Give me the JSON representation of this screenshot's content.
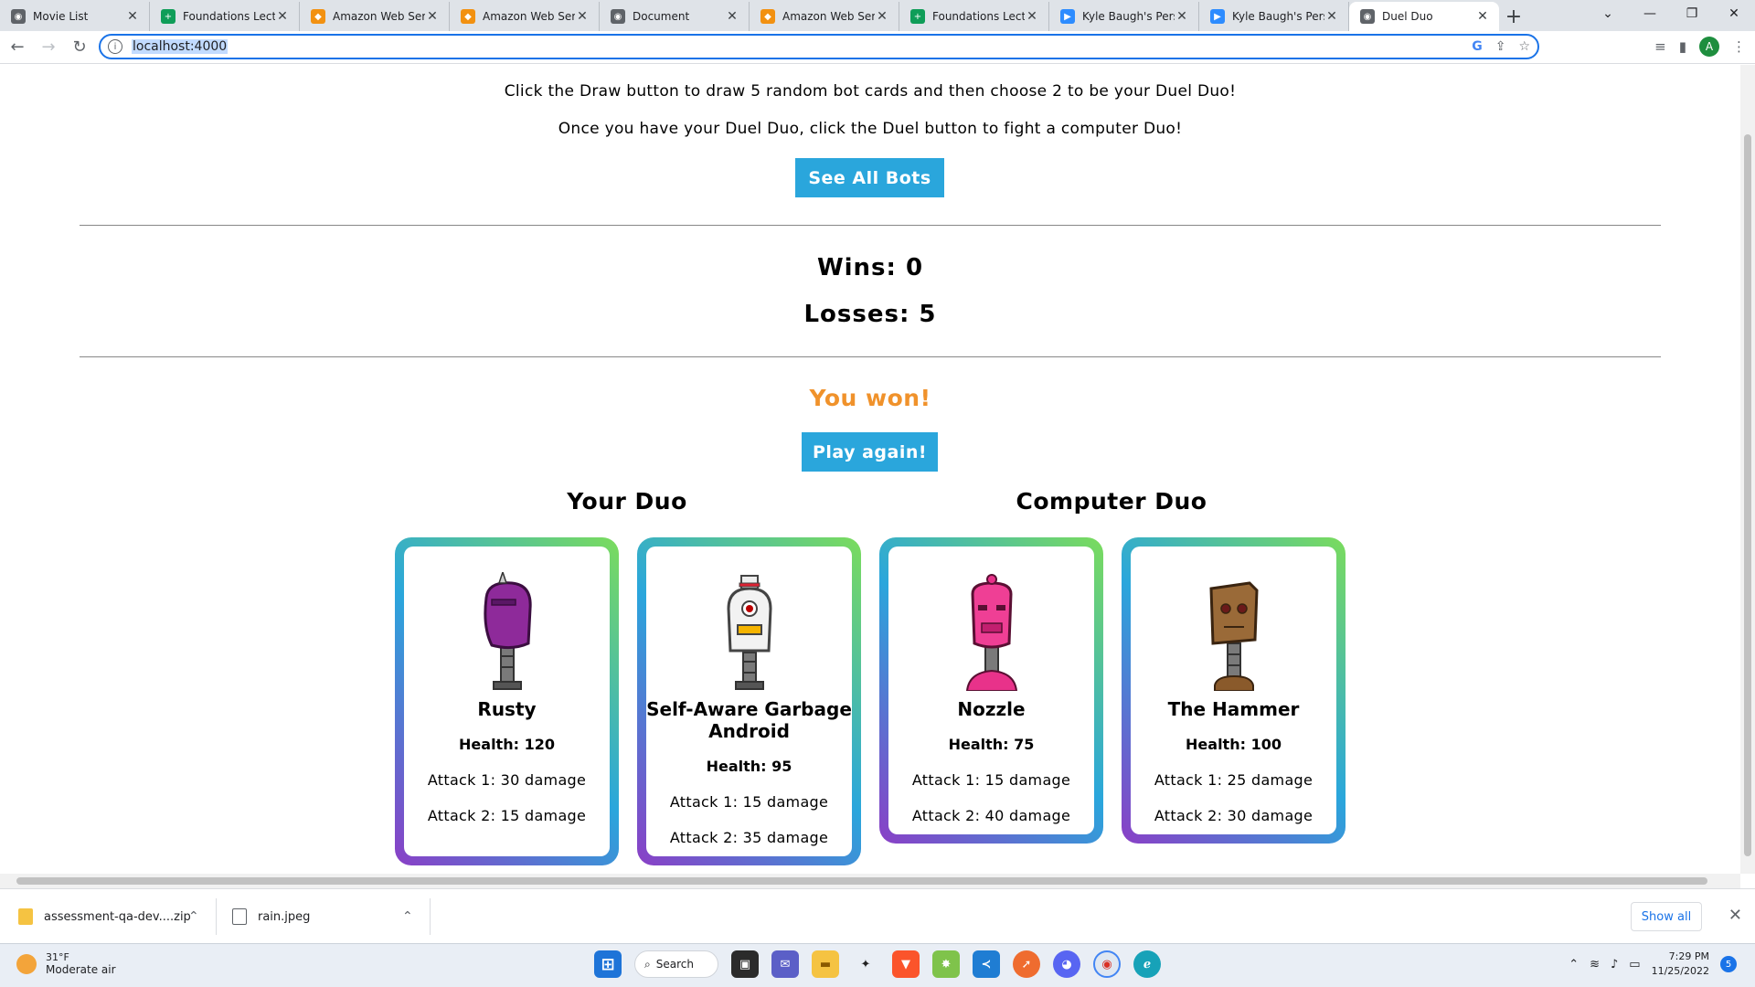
{
  "browser": {
    "tabs": [
      {
        "title": "Movie List",
        "color": "#5f6368"
      },
      {
        "title": "Foundations Lectu",
        "color": "#0f9d58"
      },
      {
        "title": "Amazon Web Serv",
        "color": "#f29111"
      },
      {
        "title": "Amazon Web Serv",
        "color": "#f29111"
      },
      {
        "title": "Document",
        "color": "#5f6368"
      },
      {
        "title": "Amazon Web Serv",
        "color": "#f29111"
      },
      {
        "title": "Foundations Lectu",
        "color": "#0f9d58"
      },
      {
        "title": "Kyle Baugh's Perso",
        "color": "#2d8cff"
      },
      {
        "title": "Kyle Baugh's Perso",
        "color": "#2d8cff"
      },
      {
        "title": "Duel Duo",
        "color": "#5f6368"
      }
    ],
    "url": "localhost:4000",
    "profile_initial": "A"
  },
  "page": {
    "instruction_1": "Click the Draw button to draw 5 random bot cards and then choose 2 to be your Duel Duo!",
    "instruction_2": "Once you have your Duel Duo, click the Duel button to fight a computer Duo!",
    "see_all_label": "See All Bots",
    "wins": "Wins: 0",
    "losses": "Losses: 5",
    "result": "You won!",
    "play_again_label": "Play again!",
    "your_duo_title": "Your Duo",
    "computer_duo_title": "Computer Duo",
    "your_duo": [
      {
        "name": "Rusty",
        "health": "Health: 120",
        "attack1": "Attack 1: 30 damage",
        "attack2": "Attack 2: 15 damage"
      },
      {
        "name": "Self-Aware Garbage Android",
        "health": "Health: 95",
        "attack1": "Attack 1: 15 damage",
        "attack2": "Attack 2: 35 damage"
      }
    ],
    "computer_duo": [
      {
        "name": "Nozzle",
        "health": "Health: 75",
        "attack1": "Attack 1: 15 damage",
        "attack2": "Attack 2: 40 damage"
      },
      {
        "name": "The Hammer",
        "health": "Health: 100",
        "attack1": "Attack 1: 25 damage",
        "attack2": "Attack 2: 30 damage"
      }
    ]
  },
  "downloads": {
    "items": [
      "assessment-qa-dev....zip",
      "rain.jpeg"
    ],
    "show_all": "Show all"
  },
  "taskbar": {
    "temp": "31°F",
    "weather": "Moderate air",
    "search": "Search",
    "time": "7:29 PM",
    "date": "11/25/2022",
    "notif_count": "5"
  }
}
